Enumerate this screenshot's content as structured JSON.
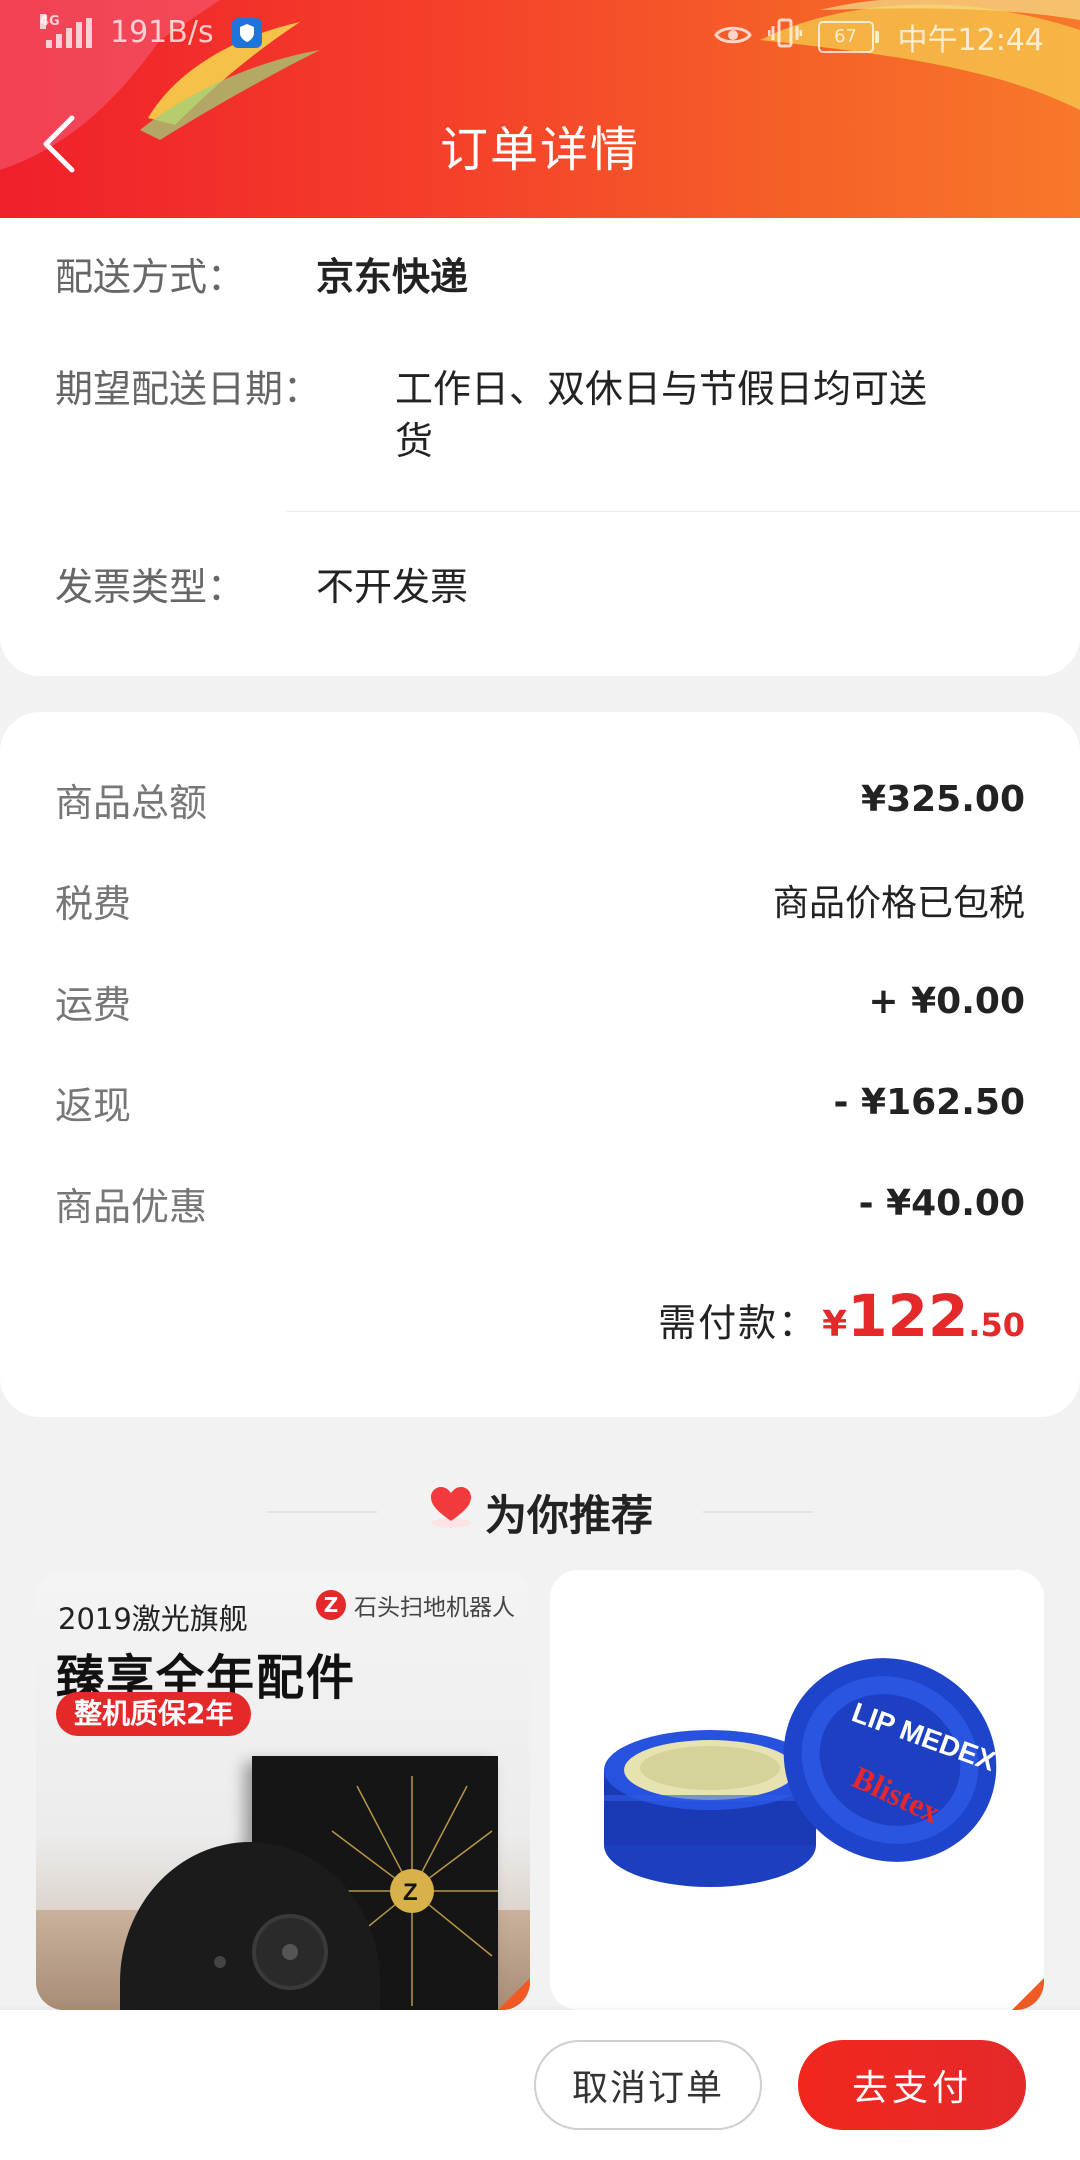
{
  "status_bar": {
    "network": "4G",
    "speed": "191B/s",
    "battery": "67",
    "time": "中午12:44"
  },
  "header": {
    "title": "订单详情",
    "back_icon": "chevron-left-icon"
  },
  "delivery": {
    "method_label": "配送方式：",
    "method_value": "京东快递",
    "date_label": "期望配送日期：",
    "date_value_line1": "工作日、双休日与节假日均可送",
    "date_value_line2": "货",
    "invoice_label": "发票类型：",
    "invoice_value": "不开发票"
  },
  "price_summary": {
    "rows": [
      {
        "label": "商品总额",
        "value": "¥325.00"
      },
      {
        "label": "税费",
        "value": "商品价格已包税"
      },
      {
        "label": "运费",
        "value": "+ ¥0.00"
      },
      {
        "label": "返现",
        "value": "- ¥162.50"
      },
      {
        "label": "商品优惠",
        "value": "- ¥40.00"
      }
    ],
    "total_label": "需付款：",
    "total_currency": "¥",
    "total_integer": "122",
    "total_decimal": ".50"
  },
  "recommend": {
    "title": "为你推荐",
    "products": [
      {
        "subtitle": "2019激光旗舰",
        "brand": "石头扫地机器人",
        "headline": "臻享全年配件",
        "badge": "整机质保2年"
      },
      {
        "label": "LIP MEDEX",
        "brand": "Blistex"
      }
    ]
  },
  "actions": {
    "cancel_label": "取消订单",
    "pay_label": "去支付"
  },
  "colors": {
    "accent": "#e4292b",
    "header_start": "#f01f2a",
    "header_end": "#f8782a"
  }
}
